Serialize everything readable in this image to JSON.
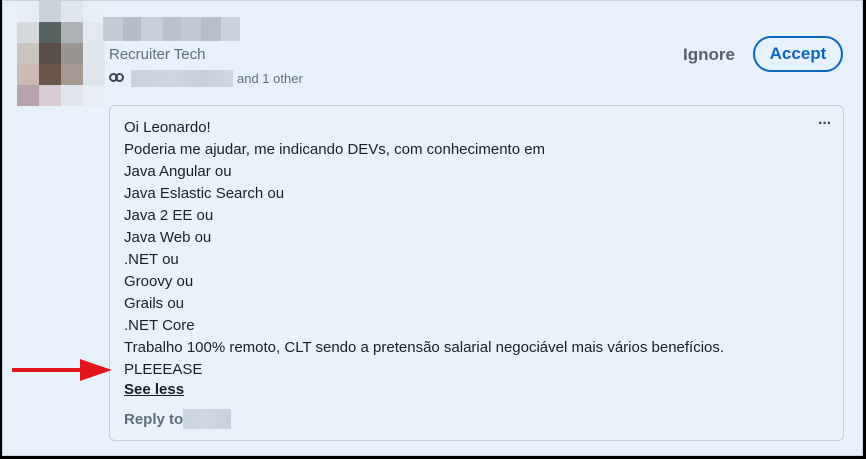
{
  "invitation": {
    "subtitle": "Recruiter Tech",
    "mutual_suffix": "and 1 other",
    "ignore_label": "Ignore",
    "accept_label": "Accept"
  },
  "message": {
    "more_label": "···",
    "lines": [
      "Oi Leonardo!",
      "Poderia me ajudar, me indicando DEVs, com conhecimento em",
      "Java Angular ou",
      "Java Eslastic Search ou",
      "Java 2 EE ou",
      "Java Web ou",
      ".NET ou",
      "Groovy ou",
      "Grails ou",
      ".NET Core",
      "Trabalho 100% remoto, CLT sendo a pretensão salarial negociável mais vários benefícios.",
      "PLEEEASE"
    ],
    "see_less_label": "See less",
    "reply_prefix": "Reply to"
  },
  "colors": {
    "accent": "#0a66c2",
    "annotation_arrow": "#e3141c",
    "background": "#e7f1fb"
  }
}
